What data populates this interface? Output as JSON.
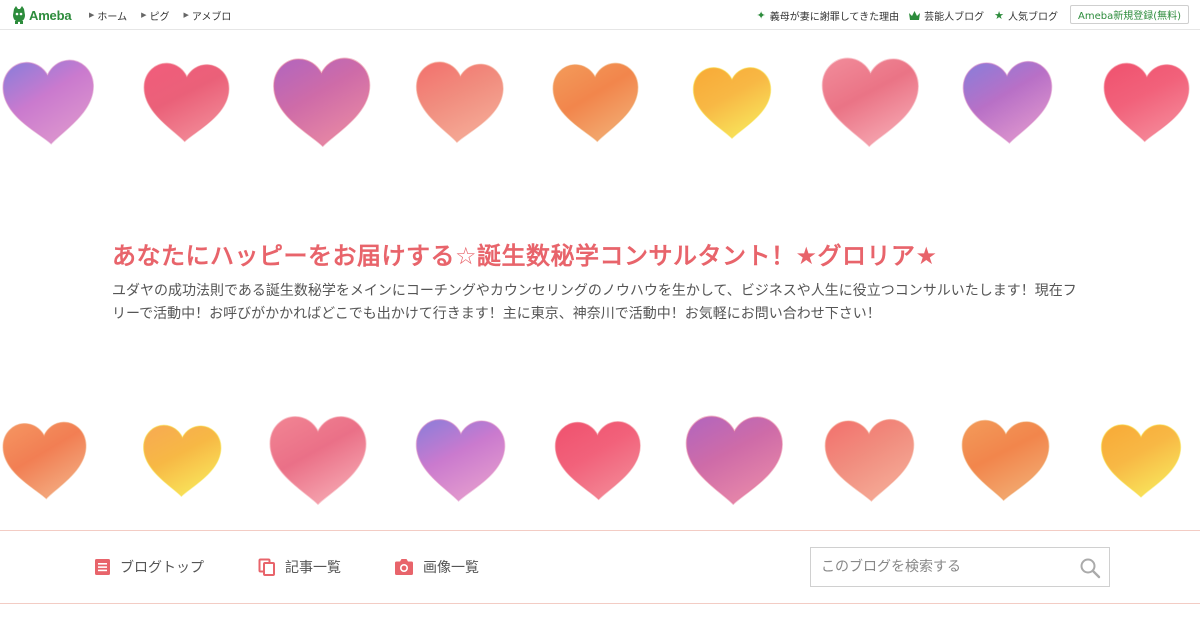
{
  "topbar": {
    "logo_text": "Ameba",
    "nav": [
      {
        "label": "ホーム"
      },
      {
        "label": "ピグ"
      },
      {
        "label": "アメブロ"
      }
    ],
    "links": [
      {
        "label": "義母が妻に謝罪してきた理由",
        "icon": "sparkle-icon"
      },
      {
        "label": "芸能人ブログ",
        "icon": "crown-icon"
      },
      {
        "label": "人気ブログ",
        "icon": "star-icon"
      }
    ],
    "register_label": "Ameba新規登録(無料)"
  },
  "header": {
    "title": "あなたにハッピーをお届けする☆誕生数秘学コンサルタント！★グロリア★",
    "description": "ユダヤの成功法則である誕生数秘学をメインにコーチングやカウンセリングのノウハウを生かして、ビジネスや人生に役立つコンサルいたします！現在フリーで活動中！お呼びがかかればどこでも出かけて行きます！主に東京、神奈川で活動中！お気軽にお問い合わせ下さい！",
    "title_color": "#e8646b"
  },
  "blognav": {
    "items": [
      {
        "label": "ブログトップ",
        "icon": "blog-top-icon"
      },
      {
        "label": "記事一覧",
        "icon": "article-list-icon"
      },
      {
        "label": "画像一覧",
        "icon": "camera-icon"
      }
    ],
    "search_placeholder": "このブログを検索する",
    "accent": "#e8646b"
  }
}
